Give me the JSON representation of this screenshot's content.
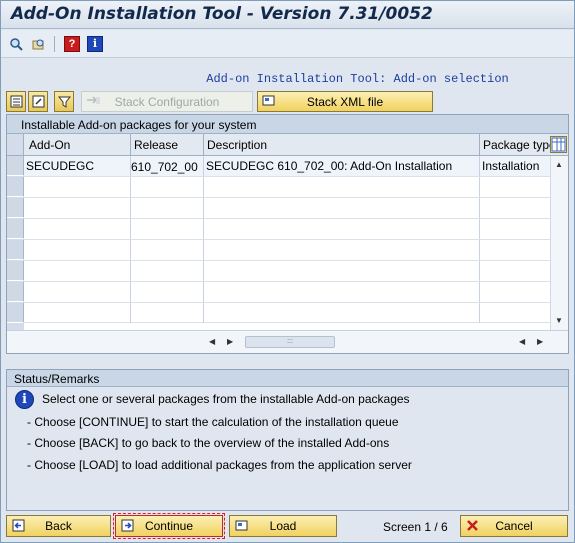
{
  "window": {
    "title": "Add-On Installation Tool - Version 7.31/0052"
  },
  "toolbar": {
    "icons": [
      "find-icon",
      "find-next-icon",
      "help-icon",
      "info-icon"
    ]
  },
  "subtitle": "Add-on Installation Tool: Add-on selection",
  "app_toolbar": {
    "stack_configuration": "Stack Configuration",
    "stack_xml_file": "Stack XML file"
  },
  "grid": {
    "title": "Installable Add-on packages for your system",
    "columns": [
      "Add-On",
      "Release",
      "Description",
      "Package type"
    ],
    "rows": [
      {
        "addon": "SECUDEGC",
        "release": "610_702_00",
        "description": "SECUDEGC 610_702_00: Add-On Installation",
        "package_type": "Installation"
      }
    ]
  },
  "status": {
    "title": "Status/Remarks",
    "lines": [
      "Select one or several packages from the installable Add-on packages",
      "- Choose [CONTINUE] to start the calculation of the installation queue",
      "- Choose [BACK] to go back to the overview of the installed Add-ons",
      "- Choose [LOAD] to load additional packages from the application server"
    ]
  },
  "footer": {
    "back": "Back",
    "continue": "Continue",
    "load": "Load",
    "screen": "Screen 1 / 6",
    "cancel": "Cancel"
  },
  "colors": {
    "button_yellow": "#f1d25f",
    "panel_header": "#c9d6e5",
    "background": "#dfe6ef",
    "info_blue": "#1f47b7",
    "subtitle_blue": "#1c3f9e"
  }
}
